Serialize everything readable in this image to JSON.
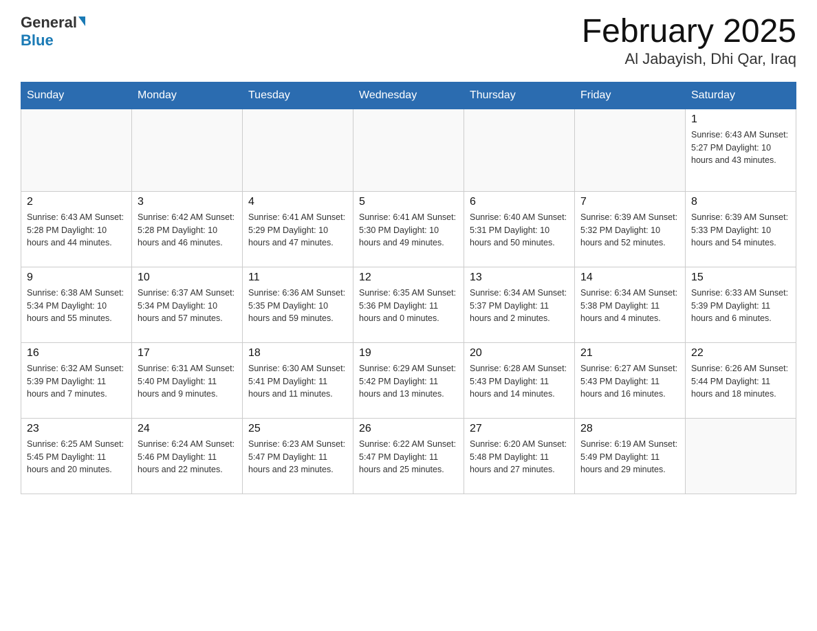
{
  "header": {
    "logo_general": "General",
    "logo_blue": "Blue",
    "title": "February 2025",
    "subtitle": "Al Jabayish, Dhi Qar, Iraq"
  },
  "days_of_week": [
    "Sunday",
    "Monday",
    "Tuesday",
    "Wednesday",
    "Thursday",
    "Friday",
    "Saturday"
  ],
  "weeks": [
    [
      {
        "day": "",
        "info": ""
      },
      {
        "day": "",
        "info": ""
      },
      {
        "day": "",
        "info": ""
      },
      {
        "day": "",
        "info": ""
      },
      {
        "day": "",
        "info": ""
      },
      {
        "day": "",
        "info": ""
      },
      {
        "day": "1",
        "info": "Sunrise: 6:43 AM\nSunset: 5:27 PM\nDaylight: 10 hours and 43 minutes."
      }
    ],
    [
      {
        "day": "2",
        "info": "Sunrise: 6:43 AM\nSunset: 5:28 PM\nDaylight: 10 hours and 44 minutes."
      },
      {
        "day": "3",
        "info": "Sunrise: 6:42 AM\nSunset: 5:28 PM\nDaylight: 10 hours and 46 minutes."
      },
      {
        "day": "4",
        "info": "Sunrise: 6:41 AM\nSunset: 5:29 PM\nDaylight: 10 hours and 47 minutes."
      },
      {
        "day": "5",
        "info": "Sunrise: 6:41 AM\nSunset: 5:30 PM\nDaylight: 10 hours and 49 minutes."
      },
      {
        "day": "6",
        "info": "Sunrise: 6:40 AM\nSunset: 5:31 PM\nDaylight: 10 hours and 50 minutes."
      },
      {
        "day": "7",
        "info": "Sunrise: 6:39 AM\nSunset: 5:32 PM\nDaylight: 10 hours and 52 minutes."
      },
      {
        "day": "8",
        "info": "Sunrise: 6:39 AM\nSunset: 5:33 PM\nDaylight: 10 hours and 54 minutes."
      }
    ],
    [
      {
        "day": "9",
        "info": "Sunrise: 6:38 AM\nSunset: 5:34 PM\nDaylight: 10 hours and 55 minutes."
      },
      {
        "day": "10",
        "info": "Sunrise: 6:37 AM\nSunset: 5:34 PM\nDaylight: 10 hours and 57 minutes."
      },
      {
        "day": "11",
        "info": "Sunrise: 6:36 AM\nSunset: 5:35 PM\nDaylight: 10 hours and 59 minutes."
      },
      {
        "day": "12",
        "info": "Sunrise: 6:35 AM\nSunset: 5:36 PM\nDaylight: 11 hours and 0 minutes."
      },
      {
        "day": "13",
        "info": "Sunrise: 6:34 AM\nSunset: 5:37 PM\nDaylight: 11 hours and 2 minutes."
      },
      {
        "day": "14",
        "info": "Sunrise: 6:34 AM\nSunset: 5:38 PM\nDaylight: 11 hours and 4 minutes."
      },
      {
        "day": "15",
        "info": "Sunrise: 6:33 AM\nSunset: 5:39 PM\nDaylight: 11 hours and 6 minutes."
      }
    ],
    [
      {
        "day": "16",
        "info": "Sunrise: 6:32 AM\nSunset: 5:39 PM\nDaylight: 11 hours and 7 minutes."
      },
      {
        "day": "17",
        "info": "Sunrise: 6:31 AM\nSunset: 5:40 PM\nDaylight: 11 hours and 9 minutes."
      },
      {
        "day": "18",
        "info": "Sunrise: 6:30 AM\nSunset: 5:41 PM\nDaylight: 11 hours and 11 minutes."
      },
      {
        "day": "19",
        "info": "Sunrise: 6:29 AM\nSunset: 5:42 PM\nDaylight: 11 hours and 13 minutes."
      },
      {
        "day": "20",
        "info": "Sunrise: 6:28 AM\nSunset: 5:43 PM\nDaylight: 11 hours and 14 minutes."
      },
      {
        "day": "21",
        "info": "Sunrise: 6:27 AM\nSunset: 5:43 PM\nDaylight: 11 hours and 16 minutes."
      },
      {
        "day": "22",
        "info": "Sunrise: 6:26 AM\nSunset: 5:44 PM\nDaylight: 11 hours and 18 minutes."
      }
    ],
    [
      {
        "day": "23",
        "info": "Sunrise: 6:25 AM\nSunset: 5:45 PM\nDaylight: 11 hours and 20 minutes."
      },
      {
        "day": "24",
        "info": "Sunrise: 6:24 AM\nSunset: 5:46 PM\nDaylight: 11 hours and 22 minutes."
      },
      {
        "day": "25",
        "info": "Sunrise: 6:23 AM\nSunset: 5:47 PM\nDaylight: 11 hours and 23 minutes."
      },
      {
        "day": "26",
        "info": "Sunrise: 6:22 AM\nSunset: 5:47 PM\nDaylight: 11 hours and 25 minutes."
      },
      {
        "day": "27",
        "info": "Sunrise: 6:20 AM\nSunset: 5:48 PM\nDaylight: 11 hours and 27 minutes."
      },
      {
        "day": "28",
        "info": "Sunrise: 6:19 AM\nSunset: 5:49 PM\nDaylight: 11 hours and 29 minutes."
      },
      {
        "day": "",
        "info": ""
      }
    ]
  ]
}
